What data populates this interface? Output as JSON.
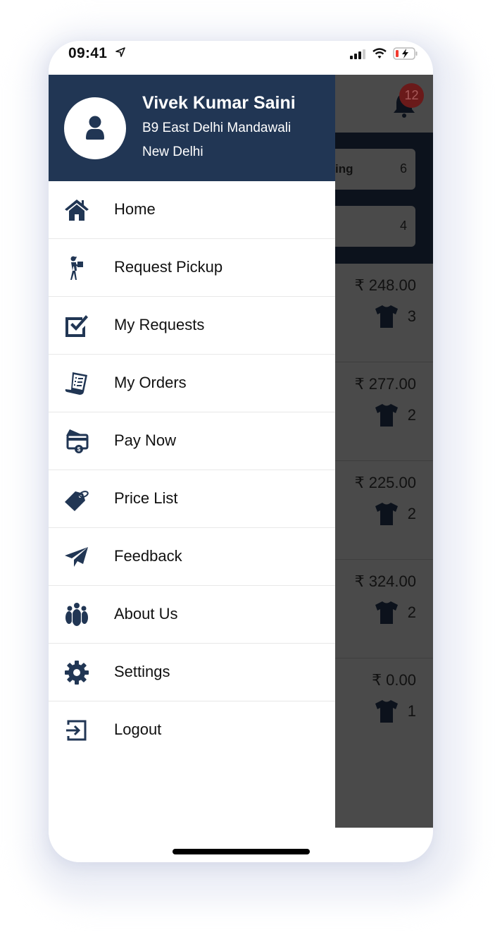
{
  "status_bar": {
    "time": "09:41",
    "icons": [
      "location-arrow-icon",
      "signal-icon",
      "wifi-icon",
      "battery-charging-icon"
    ]
  },
  "drawer": {
    "header": {
      "avatar_icon": "user-icon",
      "name": "Vivek Kumar Saini",
      "address_line1": "B9 East Delhi Mandawali",
      "address_line2": "New Delhi"
    },
    "items": [
      {
        "label": "Home",
        "icon": "home-icon"
      },
      {
        "label": "Request Pickup",
        "icon": "delivery-person-icon"
      },
      {
        "label": "My Requests",
        "icon": "checkbox-icon"
      },
      {
        "label": "My Orders",
        "icon": "receipt-icon"
      },
      {
        "label": "Pay Now",
        "icon": "card-payment-icon"
      },
      {
        "label": "Price List",
        "icon": "price-tag-icon"
      },
      {
        "label": "Feedback",
        "icon": "paper-plane-icon"
      },
      {
        "label": "About Us",
        "icon": "group-icon"
      },
      {
        "label": "Settings",
        "icon": "gear-icon"
      },
      {
        "label": "Logout",
        "icon": "logout-icon"
      }
    ]
  },
  "background_screen": {
    "notification_count": "12",
    "stats": [
      {
        "label": "ing",
        "count": "6"
      },
      {
        "label": "",
        "count": "4"
      }
    ],
    "orders": [
      {
        "amount": "₹ 248.00",
        "items": "3"
      },
      {
        "amount": "₹ 277.00",
        "items": "2"
      },
      {
        "amount": "₹ 225.00",
        "items": "2"
      },
      {
        "amount": "₹ 324.00",
        "items": "2"
      },
      {
        "amount": "₹ 0.00",
        "items": "1"
      }
    ]
  },
  "colors": {
    "drawer_header": "#213654",
    "icon": "#213654",
    "overlay": "#4a4a4a",
    "badge": "#6a1a1a"
  }
}
